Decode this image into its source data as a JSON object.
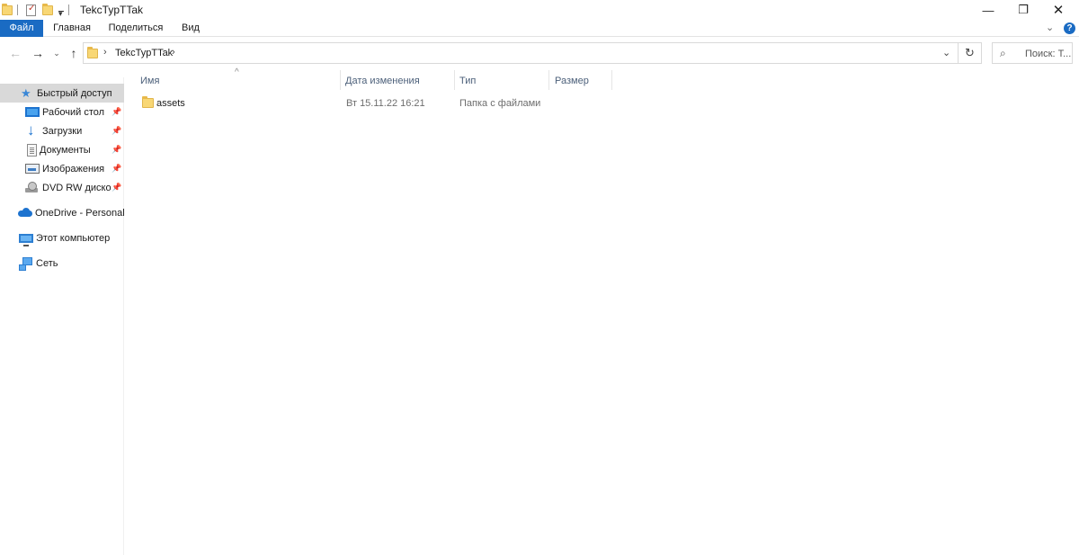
{
  "window": {
    "title": "TekcTypTTak",
    "minimize_glyph": "—",
    "maximize_glyph": "❐",
    "close_glyph": "✕"
  },
  "ribbon": {
    "tabs": [
      "Файл",
      "Главная",
      "Поделиться",
      "Вид"
    ],
    "active_tab": "Файл",
    "accent_color": "#1a6bc3",
    "expand_glyph": "⌄",
    "help_glyph": "?"
  },
  "nav": {
    "back_glyph": "←",
    "forward_glyph": "→",
    "recent_glyph": "⌄",
    "up_glyph": "↑",
    "path": [
      "TekcTypTTak"
    ],
    "refresh_glyph": "↻",
    "dropdown_glyph": "⌄",
    "search_placeholder": "Поиск: T..."
  },
  "sidebar": {
    "items": [
      {
        "label": "Быстрый доступ",
        "icon": "star-icon",
        "selected": true
      },
      {
        "label": "Рабочий стол",
        "icon": "desktop-icon",
        "pinned": true
      },
      {
        "label": "Загрузки",
        "icon": "download-icon",
        "pinned": true
      },
      {
        "label": "Документы",
        "icon": "documents-icon",
        "pinned": true
      },
      {
        "label": "Изображения",
        "icon": "pictures-icon",
        "pinned": true
      },
      {
        "label": "DVD RW дисково",
        "icon": "dvd-drive-icon",
        "pinned": true
      },
      {
        "label": "OneDrive - Personal",
        "icon": "onedrive-icon"
      },
      {
        "label": "Этот компьютер",
        "icon": "computer-icon"
      },
      {
        "label": "Сеть",
        "icon": "network-icon"
      }
    ]
  },
  "file_list": {
    "columns": [
      "Имя",
      "Дата изменения",
      "Тип",
      "Размер"
    ],
    "sort_glyph": "^",
    "rows": [
      {
        "name": "assets",
        "date": "Вт 15.11.22 16:21",
        "type": "Папка с файлами",
        "size": ""
      }
    ]
  }
}
